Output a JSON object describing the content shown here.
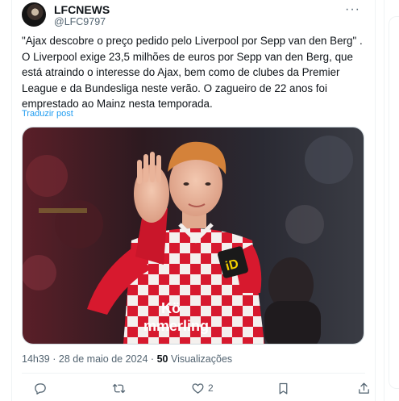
{
  "tweet": {
    "author_name": "LFCNEWS",
    "author_handle": "@LFC9797",
    "more_label": "···",
    "text": "\"Ajax descobre o preço pedido pelo Liverpool por Sepp van den Berg\" . O Liverpool exige 23,5 milhões de euros por Sepp van den Berg, que está atraindo o interesse do Ajax, bem como de clubes da Premier League e da Bundesliga neste verão. O zagueiro de 22 anos foi emprestado ao Mainz nesta temporada.",
    "translate_label": "Traduzir post",
    "time": "14h39",
    "separator": "·",
    "date": "28 de maio de 2024",
    "views_count": "50",
    "views_label": "Visualizações"
  },
  "media": {
    "shirt_text": "mmerling",
    "shirt_brand": "Kö"
  },
  "actions": {
    "reply_count": "",
    "retweet_count": "",
    "like_count": "2",
    "bookmark_count": "",
    "share_count": ""
  },
  "colors": {
    "link": "#1d9bf0",
    "secondary_text": "#536471",
    "shirt_red": "#d7192e"
  }
}
